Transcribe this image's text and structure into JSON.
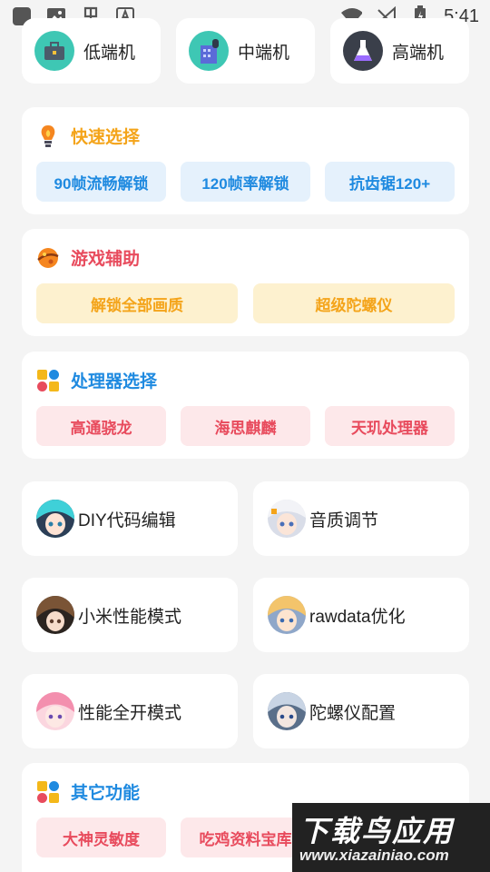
{
  "statusbar": {
    "time": "5:41",
    "left_icons": [
      "square-app-icon",
      "image-icon",
      "bug-icon",
      "font-icon"
    ],
    "right_icons": [
      "wifi-icon",
      "signal-off-icon",
      "battery-icon"
    ]
  },
  "tiers": [
    {
      "label": "低端机",
      "icon": "briefcase-icon"
    },
    {
      "label": "中端机",
      "icon": "building-icon"
    },
    {
      "label": "高端机",
      "icon": "flask-icon"
    }
  ],
  "quick": {
    "title": "快速选择",
    "icon": "bulb-icon",
    "buttons": [
      "90帧流畅解锁",
      "120帧率解锁",
      "抗齿锯120+"
    ]
  },
  "game": {
    "title": "游戏辅助",
    "icon": "planet-icon",
    "buttons": [
      "解锁全部画质",
      "超级陀螺仪"
    ]
  },
  "cpu": {
    "title": "处理器选择",
    "icon": "tiles-icon",
    "buttons": [
      "高通骁龙",
      "海思麒麟",
      "天玑处理器"
    ]
  },
  "features": [
    {
      "label": "DIY代码编辑",
      "icon": "avatar-teal-icon"
    },
    {
      "label": "音质调节",
      "icon": "avatar-silver-icon"
    },
    {
      "label": "小米性能模式",
      "icon": "avatar-brown-icon"
    },
    {
      "label": "rawdata优化",
      "icon": "avatar-blonde-icon"
    },
    {
      "label": "性能全开模式",
      "icon": "avatar-pink-icon"
    },
    {
      "label": "陀螺仪配置",
      "icon": "avatar-grey-icon"
    }
  ],
  "other": {
    "title": "其它功能",
    "icon": "tiles-icon",
    "buttons": [
      "大神灵敏度",
      "吃鸡资料宝库"
    ]
  },
  "watermark": {
    "title": "下载鸟应用",
    "url": "www.xiazainiao.com"
  },
  "colors": {
    "blue": "#1f8ae0",
    "orange": "#f4a41a",
    "red": "#e84b5d",
    "teal": "#3ec7b4"
  }
}
